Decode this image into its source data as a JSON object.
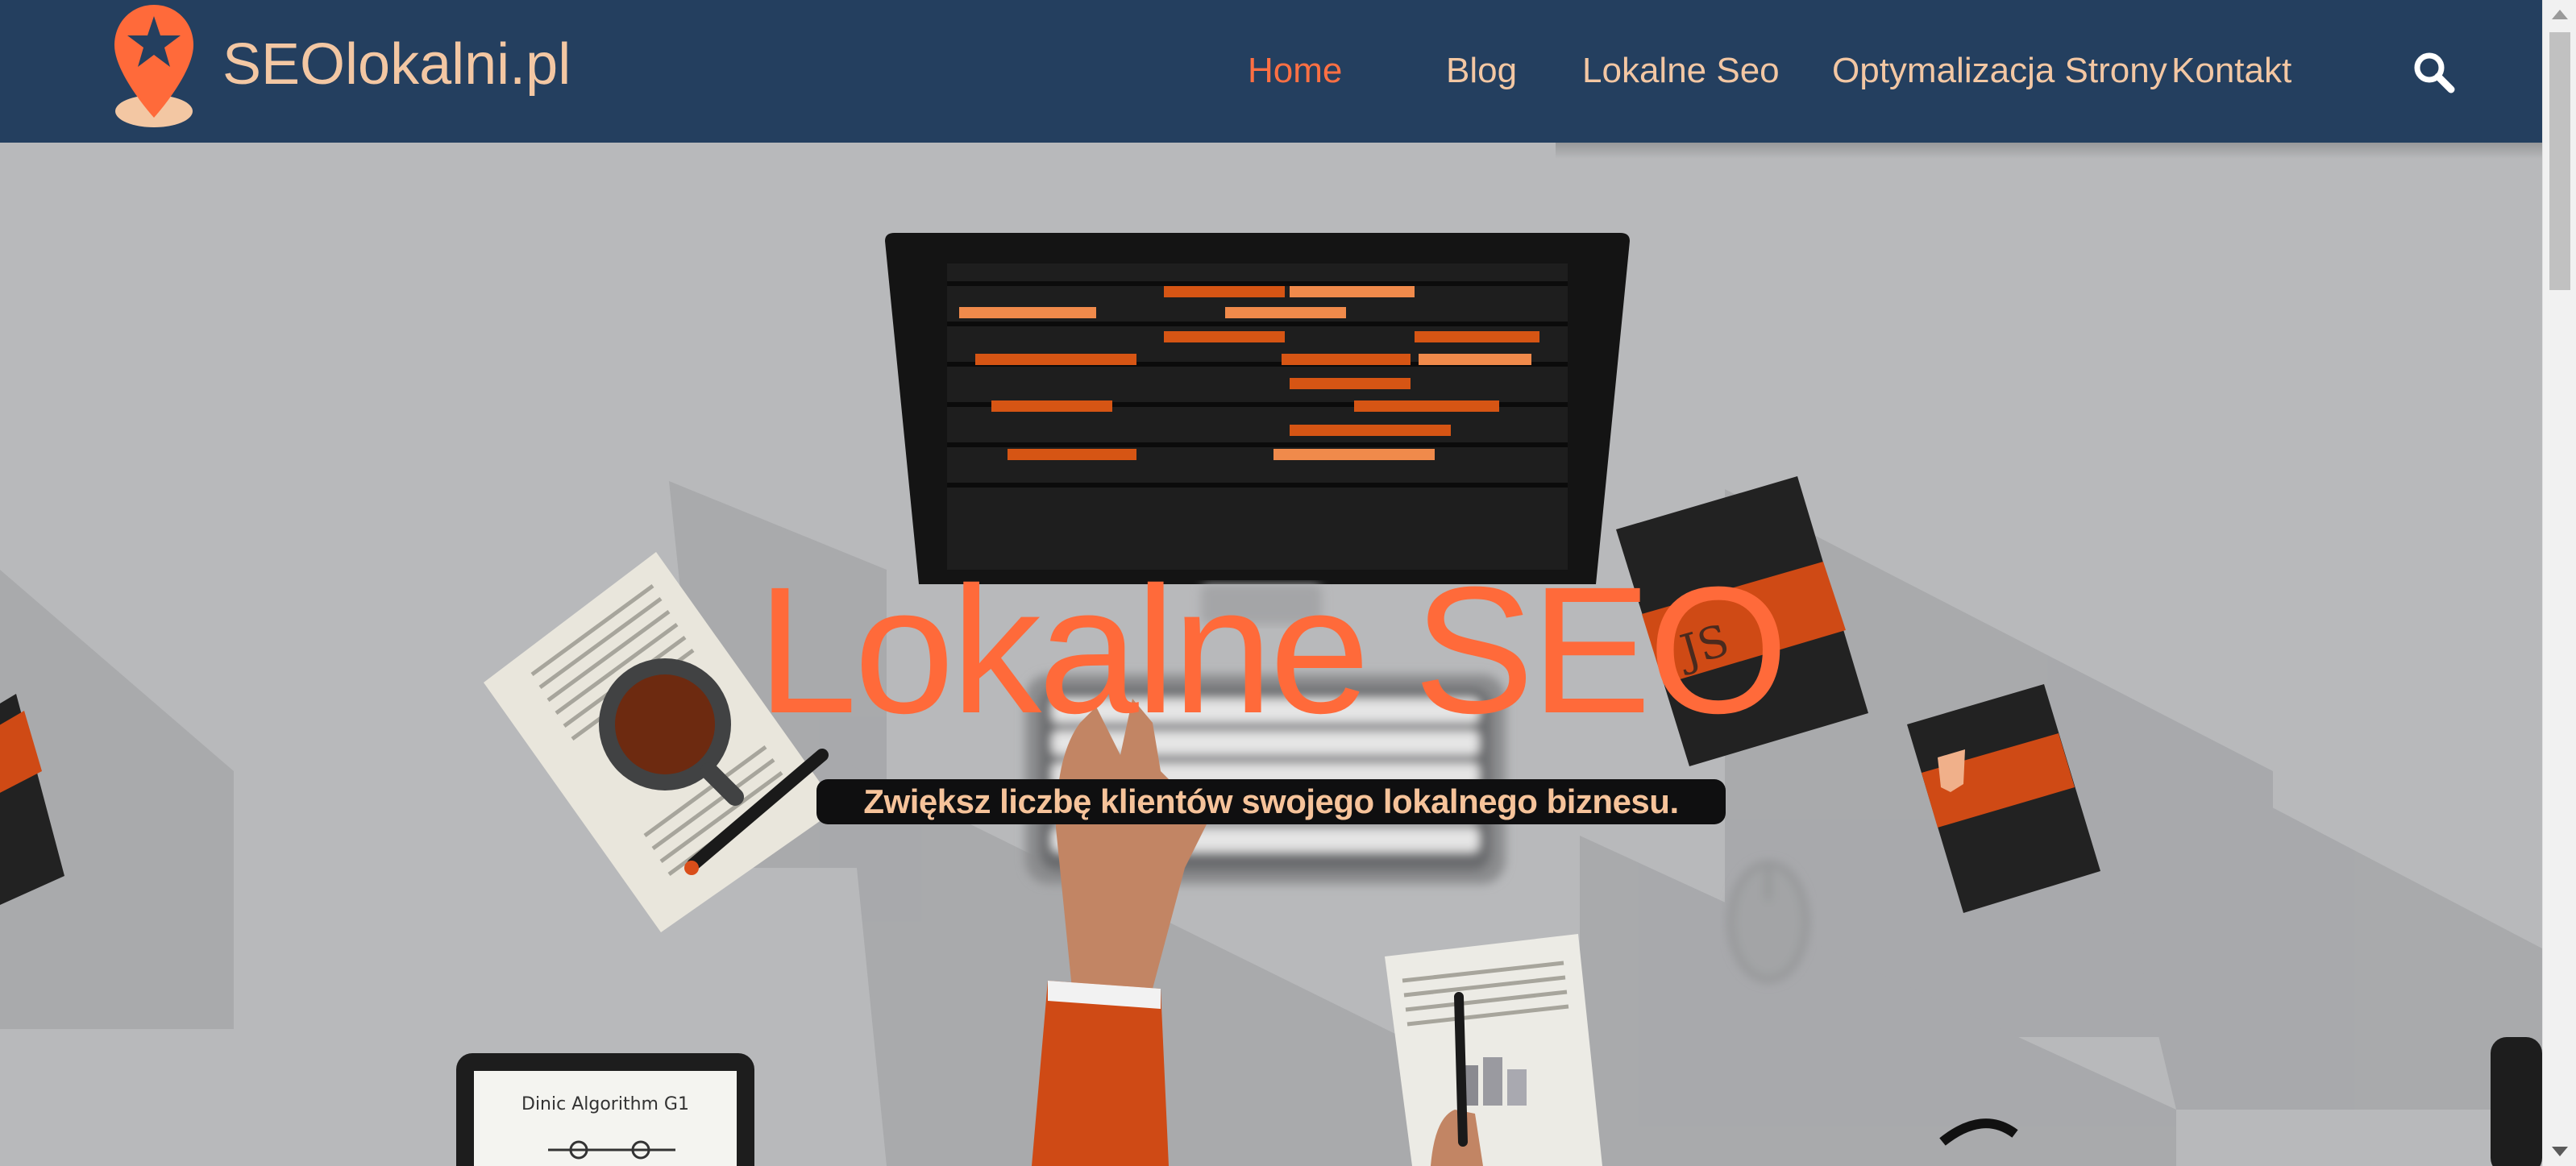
{
  "header": {
    "logo_text": "SEOlokalni.pl",
    "logo_icon": "map-pin-star-icon",
    "background_color": "#243f5f",
    "text_color": "#f3c7a3",
    "accent_color": "#ff7043"
  },
  "nav": {
    "items": [
      {
        "label": "Home",
        "active": true
      },
      {
        "label": "Blog",
        "active": false
      },
      {
        "label": "Lokalne Seo",
        "active": false
      },
      {
        "label": "Optymalizacja Strony",
        "active": false
      },
      {
        "label": "Kontakt",
        "active": false
      }
    ],
    "search_icon": "search-icon"
  },
  "hero": {
    "title": "Lokalne SEO",
    "subtitle": "Zwiększ liczbę klientów swojego lokalnego biznesu.",
    "title_color": "#ff6a3a",
    "background_color": "#b8b9bb",
    "illustration": {
      "book_label": "JS",
      "tablet_text": "Dinic Algorithm G1"
    }
  }
}
